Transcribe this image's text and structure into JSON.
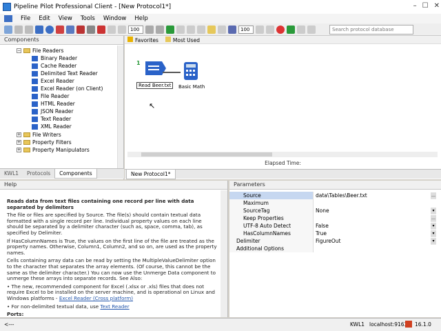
{
  "window": {
    "title": "Pipeline Pilot Professional Client - [New Protocol1*]",
    "minimize": "–",
    "maximize": "☐",
    "close": "✕"
  },
  "menu": [
    "File",
    "Edit",
    "View",
    "Tools",
    "Window",
    "Help"
  ],
  "toolbar": {
    "zoom_left": "100",
    "zoom_right": "100"
  },
  "search": {
    "placeholder": "Search protocol database"
  },
  "components": {
    "title": "Components",
    "tree": [
      {
        "label": "File Readers",
        "type": "folder",
        "expanded": true
      },
      {
        "label": "Binary Reader",
        "type": "item"
      },
      {
        "label": "Cache Reader",
        "type": "item"
      },
      {
        "label": "Delimited Text Reader",
        "type": "item"
      },
      {
        "label": "Excel Reader",
        "type": "item"
      },
      {
        "label": "Excel Reader (on Client)",
        "type": "item"
      },
      {
        "label": "File Reader",
        "type": "item"
      },
      {
        "label": "HTML Reader",
        "type": "item"
      },
      {
        "label": "JSON Reader",
        "type": "item"
      },
      {
        "label": "Text Reader",
        "type": "item"
      },
      {
        "label": "XML Reader",
        "type": "item"
      },
      {
        "label": "File Writers",
        "type": "folder",
        "expanded": false
      },
      {
        "label": "Property Filters",
        "type": "folder",
        "expanded": false
      },
      {
        "label": "Property Manipulators",
        "type": "folder",
        "expanded": false
      }
    ],
    "tabs": [
      "KWL1",
      "Protocols",
      "Components"
    ],
    "active_tab": "Components"
  },
  "canvas": {
    "favorites": "Favorites",
    "most_used": "Most Used",
    "node1_label": "Read Beer.txt",
    "node1_badge": "1",
    "node2_label": "Basic Math",
    "elapsed": "Elapsed Time:",
    "tab": "New Protocol1*"
  },
  "help": {
    "title": "Help",
    "heading": "Reads data from text files containing one record per line with data separated by delimiters",
    "p1": "The file or files are specified by Source. The file(s) should contain textual data formatted with a single record per line. Individual property values on each line should be separated by a delimiter character (such as, space, comma, tab), as specified by Delimiter.",
    "p2": "If HasColumnNames is True, the values on the first line of the file are treated as the property names. Otherwise, Column1, Column2, and so on, are used as the property names.",
    "p3": "Cells containing array data can be read by setting the MultipleValueDelimiter option to the character that separates the array elements. (Of course, this cannot be the same as the delimiter character.) You can now use the Unmerge Data component to unmerge these arrays into separate records. See Also:",
    "bullet1": "The new, recommended component for Excel (.xlsx or .xls) files that does not require Excel to be installed on the server machine, and is operational on Linux and Windows platforms - ",
    "bullet1_link": "Excel Reader (Cross platform)",
    "bullet2": "For non-delimited textual data, use ",
    "bullet2_link": "Text Reader",
    "ports": "Ports:"
  },
  "parameters": {
    "title": "Parameters",
    "rows": [
      {
        "name": "Source",
        "value": "data\\Tables\\Beer.txt",
        "selected": true
      },
      {
        "name": "Maximum",
        "value": ""
      },
      {
        "name": "SourceTag",
        "value": "None"
      },
      {
        "name": "Keep Properties",
        "value": ""
      },
      {
        "name": "UTF-8 Auto Detect",
        "value": "False"
      },
      {
        "name": "HasColumnNames",
        "value": "True"
      },
      {
        "name": "Delimiter",
        "value": "FigureOut"
      },
      {
        "name": "Additional Options",
        "value": ""
      }
    ]
  },
  "status": {
    "left": "<---",
    "server_name": "KWL1",
    "host": "localhost:9163",
    "version": "16.1.0"
  }
}
